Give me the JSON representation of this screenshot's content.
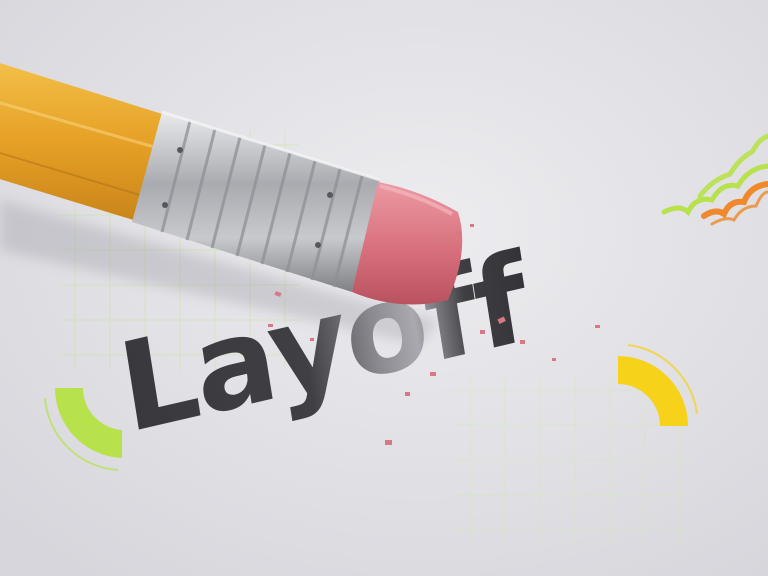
{
  "image": {
    "word": "Layoff",
    "colors": {
      "paper": "#e4e4e8",
      "ink": "#3d3d42",
      "pencil_body": "#e9a82a",
      "ferrule": "#b9bbbf",
      "eraser": "#d9737f",
      "accent_green": "#b4e34a",
      "accent_yellow": "#f7d51c",
      "accent_orange": "#ef8b2c"
    },
    "icons": [
      "pencil-icon",
      "eraser-icon",
      "green-arc-icon",
      "yellow-arc-icon",
      "orange-zigzag-icon",
      "green-zigzag-icon"
    ]
  }
}
